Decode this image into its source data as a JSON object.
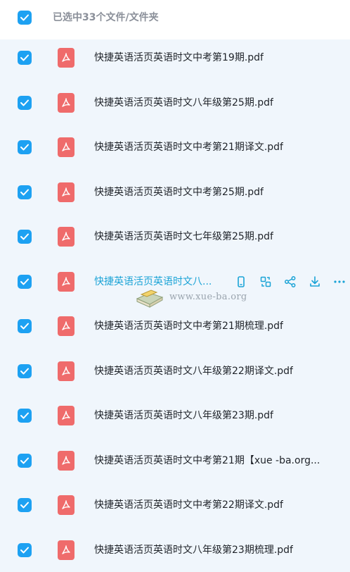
{
  "header": {
    "selection_label": "已选中33个文件/文件夹"
  },
  "files": [
    {
      "name": "快捷英语活页英语时文中考第19期.pdf"
    },
    {
      "name": "快捷英语活页英语时文八年级第25期.pdf"
    },
    {
      "name": "快捷英语活页英语时文中考第21期译文.pdf"
    },
    {
      "name": "快捷英语活页英语时文中考第25期.pdf"
    },
    {
      "name": "快捷英语活页英语时文七年级第25期.pdf"
    },
    {
      "name": "快捷英语活页英语时文八..."
    },
    {
      "name": "快捷英语活页英语时文中考第21期梳理.pdf"
    },
    {
      "name": "快捷英语活页英语时文八年级第22期译文.pdf"
    },
    {
      "name": "快捷英语活页英语时文八年级第23期.pdf"
    },
    {
      "name": "快捷英语活页英语时文中考第21期【xue -ba.org..."
    },
    {
      "name": "快捷英语活页英语时文中考第22期译文.pdf"
    },
    {
      "name": "快捷英语活页英语时文八年级第23期梳理.pdf"
    }
  ],
  "row_actions_icons": [
    "phone-icon",
    "convert-icon",
    "share-icon",
    "download-icon",
    "more-icon"
  ],
  "watermark": {
    "text": "www.xue-ba.org"
  },
  "colors": {
    "accent": "#1da1f2",
    "pdf_icon": "#ef6b6b",
    "active_text": "#1aa3d6",
    "background": "#f0f6fc"
  }
}
